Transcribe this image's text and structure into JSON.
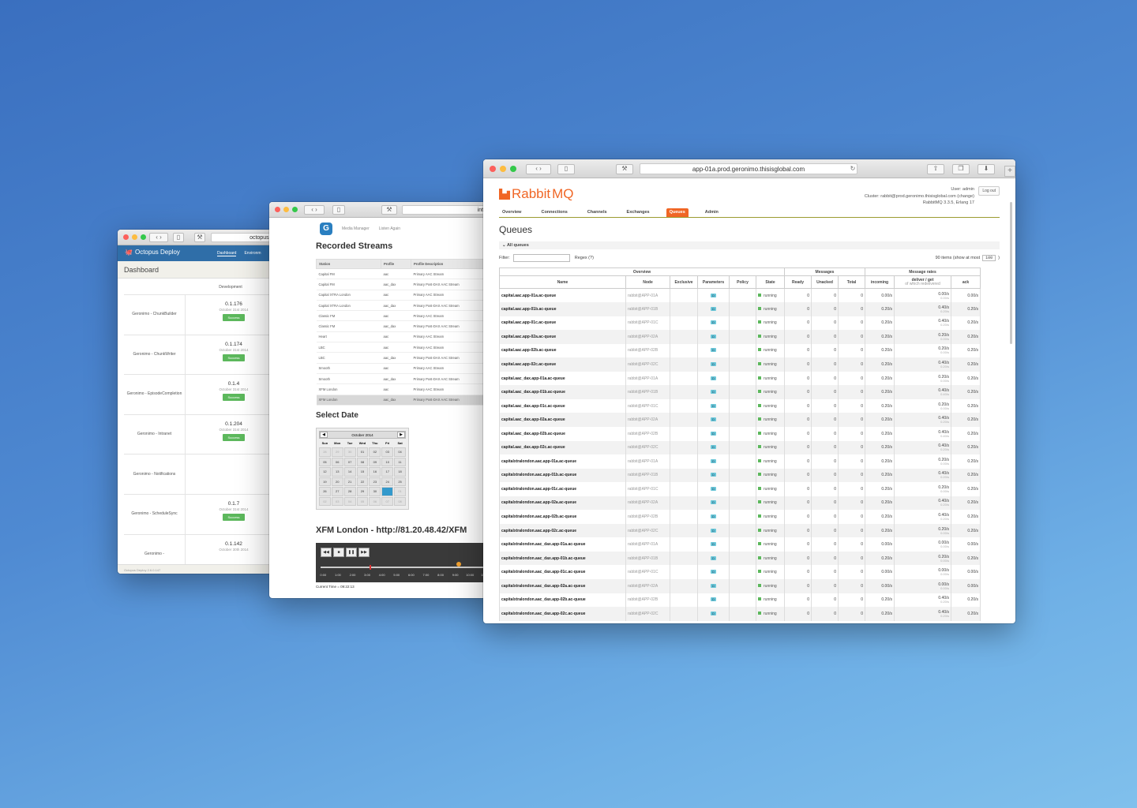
{
  "octopus": {
    "url": "octopus.geroni",
    "brand": "Octopus Deploy",
    "nav_tabs": [
      "Dashboard",
      "Environm"
    ],
    "title": "Dashboard",
    "column": "Development",
    "rows": [
      {
        "project": "Geronimo - ChunkBuilder",
        "version": "0.1.176",
        "date": "October 31st 2014",
        "status": "Success"
      },
      {
        "project": "Geronimo - ChunkWriter",
        "version": "0.1.174",
        "date": "October 31st 2014",
        "status": "Success"
      },
      {
        "project": "Geronimo - EpisodeCompletion",
        "version": "0.1.4",
        "date": "October 31st 2014",
        "status": "Success"
      },
      {
        "project": "Geronimo - Intranet",
        "version": "0.1.204",
        "date": "October 31st 2014",
        "status": "Success"
      },
      {
        "project": "Geronimo - Notifications",
        "version": "",
        "date": "",
        "status": ""
      },
      {
        "project": "Geronimo - ScheduleSync",
        "version": "0.1.7",
        "date": "October 31st 2014",
        "status": "Success"
      },
      {
        "project": "Geronimo -",
        "version": "0.1.142",
        "date": "October 30th 2014",
        "status": ""
      }
    ],
    "footer": "Octopus Deploy 2.6.0.147"
  },
  "intranet": {
    "url": "intranet.gero",
    "nav": [
      "Media Manager",
      "Listen Again"
    ],
    "streams_title": "Recorded Streams",
    "table_headers": [
      "Station",
      "Profile",
      "Profile Description"
    ],
    "streams": [
      [
        "Capital FM",
        "aac",
        "Primary AAC Stream"
      ],
      [
        "Capital FM",
        "aac_dax",
        "Primary Post-DAX AAC Stream"
      ],
      [
        "Capital XTRA London",
        "aac",
        "Primary AAC Stream"
      ],
      [
        "Capital XTRA London",
        "aac_dax",
        "Primary Post-DAX AAC Stream"
      ],
      [
        "Classic FM",
        "aac",
        "Primary AAC Stream"
      ],
      [
        "Classic FM",
        "aac_dax",
        "Primary Post-DAX AAC Stream"
      ],
      [
        "Heart",
        "aac",
        "Primary AAC Stream"
      ],
      [
        "LBC",
        "aac",
        "Primary AAC Stream"
      ],
      [
        "LBC",
        "aac_dax",
        "Primary Post-DAX AAC Stream"
      ],
      [
        "Smooth",
        "aac",
        "Primary AAC Stream"
      ],
      [
        "Smooth",
        "aac_dax",
        "Primary Post-DAX AAC Stream"
      ],
      [
        "XFM London",
        "aac",
        "Primary AAC Stream"
      ],
      [
        "XFM London",
        "aac_dax",
        "Primary Post-DAX AAC Stream"
      ]
    ],
    "date_title": "Select Date",
    "calendar": {
      "month": "October 2014",
      "prev": "◀",
      "next": "▶",
      "day_names": [
        "Sun",
        "Mon",
        "Tue",
        "Wed",
        "Thu",
        "Fri",
        "Sat"
      ],
      "days": [
        "28",
        "29",
        "30",
        "01",
        "02",
        "03",
        "04",
        "05",
        "06",
        "07",
        "08",
        "09",
        "10",
        "11",
        "12",
        "13",
        "14",
        "15",
        "16",
        "17",
        "18",
        "19",
        "20",
        "21",
        "22",
        "23",
        "24",
        "25",
        "26",
        "27",
        "28",
        "29",
        "30",
        "31",
        "01",
        "02",
        "03",
        "04",
        "05",
        "06",
        "07",
        "08"
      ]
    },
    "player_title": "XFM London - http://81.20.48.42/XFM",
    "ticks": [
      "0:00",
      "1:00",
      "2:00",
      "3:00",
      "4:00",
      "5:00",
      "6:00",
      "7:00",
      "8:00",
      "9:00",
      "10:00",
      "11:00"
    ],
    "current_time": "Current Time = 09:22:13"
  },
  "rabbit": {
    "url": "app-01a.prod.geronimo.thisisglobal.com",
    "brand_a": "Rabbit",
    "brand_b": "MQ",
    "user_line": "User: admin",
    "cluster_line": "Cluster: rabbit@prod.geronimo.thisisglobal.com (change)",
    "version_line": "RabbitMQ 3.3.5, Erlang 17",
    "logout": "Log out",
    "nav": [
      "Overview",
      "Connections",
      "Channels",
      "Exchanges",
      "Queues",
      "Admin"
    ],
    "page_title": "Queues",
    "section": "All queues",
    "filter_label": "Filter:",
    "regex_label": "Regex (?)",
    "items_text": "90 items (show at most",
    "items_max": "100",
    "items_close": ")",
    "group_headers": [
      "Overview",
      "Messages",
      "Message rates"
    ],
    "headers": [
      "Name",
      "Node",
      "Exclusive",
      "Parameters",
      "Policy",
      "State",
      "Ready",
      "Unacked",
      "Total",
      "incoming",
      "deliver / get",
      "ack"
    ],
    "header_sub": "of which redelivered",
    "queues": [
      {
        "name": "capital.aac.app-01a.ac-queue",
        "node": "rabbit@APP-01A",
        "param": "D",
        "state": "running",
        "ready": "0",
        "unacked": "0",
        "total": "0",
        "incoming": "0.00/s",
        "deliver": "0.00/s",
        "redeliver": "0.00/s",
        "ack": "0.00/s"
      },
      {
        "name": "capital.aac.app-01b.ac-queue",
        "node": "rabbit@APP-01B",
        "param": "D",
        "state": "running",
        "ready": "0",
        "unacked": "0",
        "total": "0",
        "incoming": "0.20/s",
        "deliver": "0.40/s",
        "redeliver": "0.20/s",
        "ack": "0.20/s"
      },
      {
        "name": "capital.aac.app-01c.ac-queue",
        "node": "rabbit@APP-01C",
        "param": "D",
        "state": "running",
        "ready": "0",
        "unacked": "0",
        "total": "0",
        "incoming": "0.20/s",
        "deliver": "0.40/s",
        "redeliver": "0.20/s",
        "ack": "0.20/s"
      },
      {
        "name": "capital.aac.app-02a.ac-queue",
        "node": "rabbit@APP-02A",
        "param": "D",
        "state": "running",
        "ready": "0",
        "unacked": "0",
        "total": "0",
        "incoming": "0.20/s",
        "deliver": "0.20/s",
        "redeliver": "0.00/s",
        "ack": "0.20/s"
      },
      {
        "name": "capital.aac.app-02b.ac-queue",
        "node": "rabbit@APP-02B",
        "param": "D",
        "state": "running",
        "ready": "0",
        "unacked": "0",
        "total": "0",
        "incoming": "0.20/s",
        "deliver": "0.20/s",
        "redeliver": "0.00/s",
        "ack": "0.20/s"
      },
      {
        "name": "capital.aac.app-02c.ac-queue",
        "node": "rabbit@APP-02C",
        "param": "D",
        "state": "running",
        "ready": "0",
        "unacked": "0",
        "total": "0",
        "incoming": "0.20/s",
        "deliver": "0.40/s",
        "redeliver": "0.20/s",
        "ack": "0.20/s"
      },
      {
        "name": "capital.aac_dax.app-01a.ac-queue",
        "node": "rabbit@APP-01A",
        "param": "D",
        "state": "running",
        "ready": "0",
        "unacked": "0",
        "total": "0",
        "incoming": "0.20/s",
        "deliver": "0.20/s",
        "redeliver": "0.00/s",
        "ack": "0.20/s"
      },
      {
        "name": "capital.aac_dax.app-01b.ac-queue",
        "node": "rabbit@APP-01B",
        "param": "D",
        "state": "running",
        "ready": "0",
        "unacked": "0",
        "total": "0",
        "incoming": "0.20/s",
        "deliver": "0.40/s",
        "redeliver": "0.40/s",
        "ack": "0.20/s"
      },
      {
        "name": "capital.aac_dax.app-01c.ac-queue",
        "node": "rabbit@APP-01C",
        "param": "D",
        "state": "running",
        "ready": "0",
        "unacked": "0",
        "total": "0",
        "incoming": "0.20/s",
        "deliver": "0.20/s",
        "redeliver": "0.00/s",
        "ack": "0.20/s"
      },
      {
        "name": "capital.aac_dax.app-02a.ac-queue",
        "node": "rabbit@APP-02A",
        "param": "D",
        "state": "running",
        "ready": "0",
        "unacked": "0",
        "total": "0",
        "incoming": "0.20/s",
        "deliver": "0.40/s",
        "redeliver": "0.20/s",
        "ack": "0.20/s"
      },
      {
        "name": "capital.aac_dax.app-02b.ac-queue",
        "node": "rabbit@APP-02B",
        "param": "D",
        "state": "running",
        "ready": "0",
        "unacked": "0",
        "total": "0",
        "incoming": "0.20/s",
        "deliver": "0.40/s",
        "redeliver": "0.40/s",
        "ack": "0.20/s"
      },
      {
        "name": "capital.aac_dax.app-02c.ac-queue",
        "node": "rabbit@APP-02C",
        "param": "D",
        "state": "running",
        "ready": "0",
        "unacked": "0",
        "total": "0",
        "incoming": "0.20/s",
        "deliver": "0.40/s",
        "redeliver": "0.20/s",
        "ack": "0.20/s"
      },
      {
        "name": "capitalxtralondon.aac.app-01a.ac-queue",
        "node": "rabbit@APP-01A",
        "param": "D",
        "state": "running",
        "ready": "0",
        "unacked": "0",
        "total": "0",
        "incoming": "0.20/s",
        "deliver": "0.20/s",
        "redeliver": "0.00/s",
        "ack": "0.20/s"
      },
      {
        "name": "capitalxtralondon.aac.app-01b.ac-queue",
        "node": "rabbit@APP-01B",
        "param": "D",
        "state": "running",
        "ready": "0",
        "unacked": "0",
        "total": "0",
        "incoming": "0.20/s",
        "deliver": "0.40/s",
        "redeliver": "0.20/s",
        "ack": "0.20/s"
      },
      {
        "name": "capitalxtralondon.aac.app-01c.ac-queue",
        "node": "rabbit@APP-01C",
        "param": "D",
        "state": "running",
        "ready": "0",
        "unacked": "0",
        "total": "0",
        "incoming": "0.20/s",
        "deliver": "0.20/s",
        "redeliver": "0.00/s",
        "ack": "0.20/s"
      },
      {
        "name": "capitalxtralondon.aac.app-02a.ac-queue",
        "node": "rabbit@APP-02A",
        "param": "D",
        "state": "running",
        "ready": "0",
        "unacked": "0",
        "total": "0",
        "incoming": "0.20/s",
        "deliver": "0.40/s",
        "redeliver": "0.20/s",
        "ack": "0.20/s"
      },
      {
        "name": "capitalxtralondon.aac.app-02b.ac-queue",
        "node": "rabbit@APP-02B",
        "param": "D",
        "state": "running",
        "ready": "0",
        "unacked": "0",
        "total": "0",
        "incoming": "0.20/s",
        "deliver": "0.40/s",
        "redeliver": "0.20/s",
        "ack": "0.20/s"
      },
      {
        "name": "capitalxtralondon.aac.app-02c.ac-queue",
        "node": "rabbit@APP-02C",
        "param": "D",
        "state": "running",
        "ready": "0",
        "unacked": "0",
        "total": "0",
        "incoming": "0.20/s",
        "deliver": "0.20/s",
        "redeliver": "0.00/s",
        "ack": "0.20/s"
      },
      {
        "name": "capitalxtralondon.aac_dax.app-01a.ac-queue",
        "node": "rabbit@APP-01A",
        "param": "D",
        "state": "running",
        "ready": "0",
        "unacked": "0",
        "total": "0",
        "incoming": "0.00/s",
        "deliver": "0.00/s",
        "redeliver": "0.00/s",
        "ack": "0.00/s"
      },
      {
        "name": "capitalxtralondon.aac_dax.app-01b.ac-queue",
        "node": "rabbit@APP-01B",
        "param": "D",
        "state": "running",
        "ready": "0",
        "unacked": "0",
        "total": "0",
        "incoming": "0.20/s",
        "deliver": "0.20/s",
        "redeliver": "0.00/s",
        "ack": "0.20/s"
      },
      {
        "name": "capitalxtralondon.aac_dax.app-01c.ac-queue",
        "node": "rabbit@APP-01C",
        "param": "D",
        "state": "running",
        "ready": "0",
        "unacked": "0",
        "total": "0",
        "incoming": "0.00/s",
        "deliver": "0.00/s",
        "redeliver": "0.00/s",
        "ack": "0.00/s"
      },
      {
        "name": "capitalxtralondon.aac_dax.app-02a.ac-queue",
        "node": "rabbit@APP-02A",
        "param": "D",
        "state": "running",
        "ready": "0",
        "unacked": "0",
        "total": "0",
        "incoming": "0.00/s",
        "deliver": "0.00/s",
        "redeliver": "0.00/s",
        "ack": "0.00/s"
      },
      {
        "name": "capitalxtralondon.aac_dax.app-02b.ac-queue",
        "node": "rabbit@APP-02B",
        "param": "D",
        "state": "running",
        "ready": "0",
        "unacked": "0",
        "total": "0",
        "incoming": "0.20/s",
        "deliver": "0.40/s",
        "redeliver": "0.20/s",
        "ack": "0.20/s"
      },
      {
        "name": "capitalxtralondon.aac_dax.app-02c.ac-queue",
        "node": "rabbit@APP-02C",
        "param": "D",
        "state": "running",
        "ready": "0",
        "unacked": "0",
        "total": "0",
        "incoming": "0.20/s",
        "deliver": "0.40/s",
        "redeliver": "0.20/s",
        "ack": "0.20/s"
      }
    ]
  }
}
